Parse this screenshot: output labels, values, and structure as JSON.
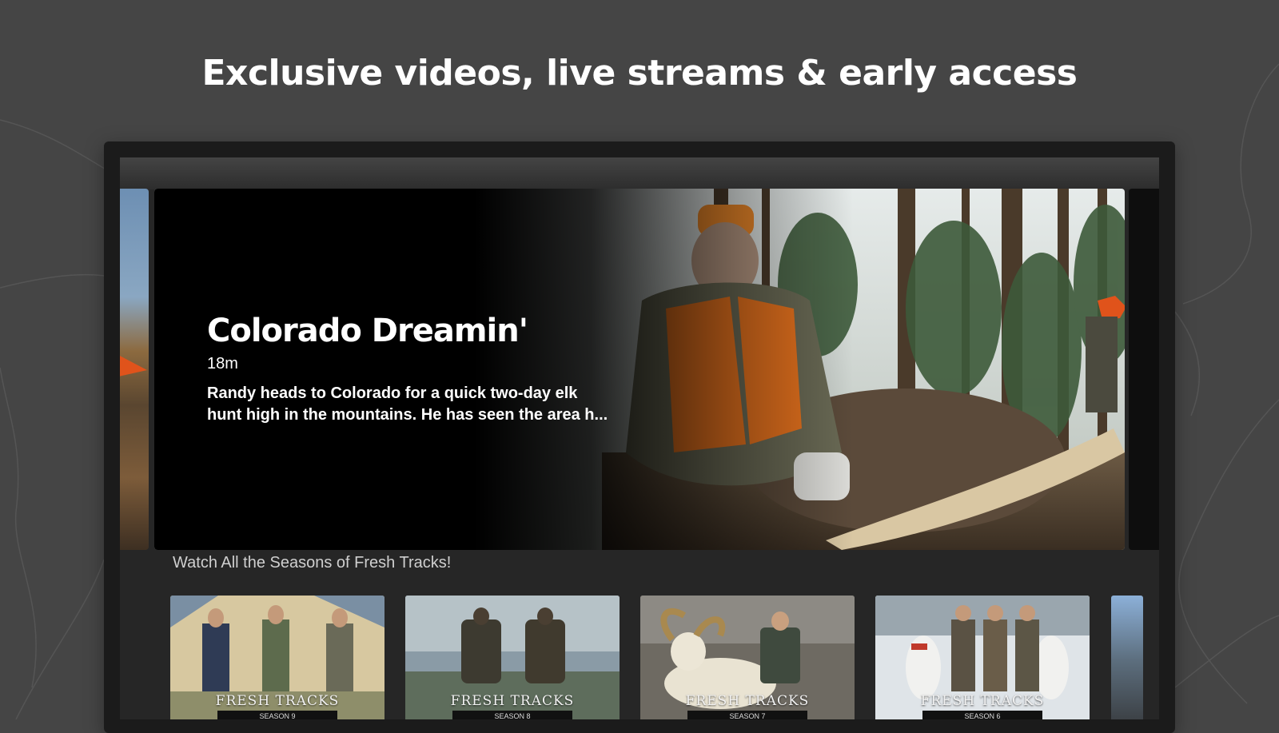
{
  "headline": "Exclusive videos, live streams & early access",
  "hero": {
    "title": "Colorado Dreamin'",
    "duration": "18m",
    "description_line1": "Randy heads to Colorado for a quick two-day elk",
    "description_line2": "hunt high in the mountains. He has seen the area h..."
  },
  "row": {
    "title": "Watch All the Seasons of Fresh Tracks!",
    "items": [
      {
        "logo": "FRESH TRACKS",
        "season": "SEASON 9"
      },
      {
        "logo": "FRESH TRACKS",
        "season": "SEASON 8"
      },
      {
        "logo": "FRESH TRACKS",
        "season": "SEASON 7"
      },
      {
        "logo": "FRESH TRACKS",
        "season": "SEASON 6"
      }
    ]
  },
  "colors": {
    "background": "#454545",
    "device_frame": "#1b1b1b",
    "text": "#ffffff",
    "hunter_orange": "#e0531b"
  }
}
